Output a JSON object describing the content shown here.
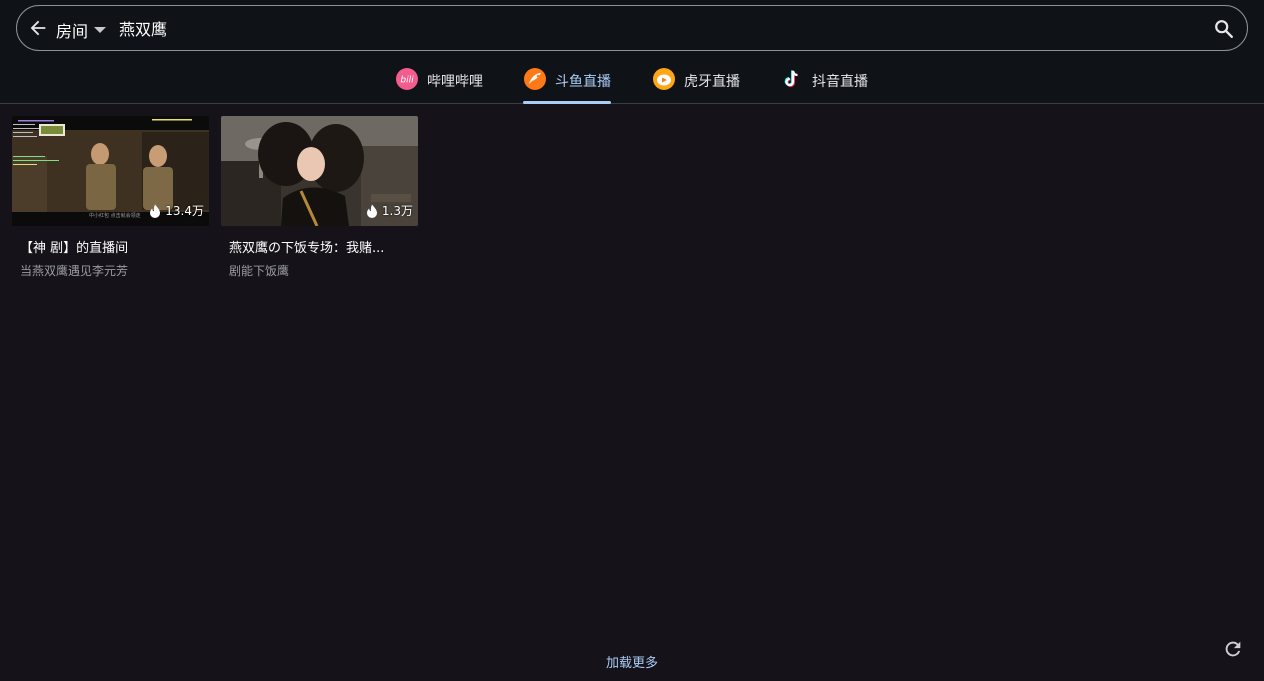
{
  "search": {
    "scope_label": "房间",
    "query": "燕双鹰"
  },
  "tabs": [
    {
      "label": "哔哩哔哩",
      "icon": "bilibili-icon",
      "active": false
    },
    {
      "label": "斗鱼直播",
      "icon": "douyu-icon",
      "active": true
    },
    {
      "label": "虎牙直播",
      "icon": "huya-icon",
      "active": false
    },
    {
      "label": "抖音直播",
      "icon": "douyin-icon",
      "active": false
    }
  ],
  "results": [
    {
      "title": "【神 剧】的直播间",
      "subtitle": "当燕双鹰遇见李元芳",
      "heat": "13.4万",
      "thumb_caption": "中小红包 点击就会领走"
    },
    {
      "title": "燕双鹰の下饭专场：我赌...",
      "subtitle": "剧能下饭鹰",
      "heat": "1.3万"
    }
  ],
  "footer": {
    "load_more": "加载更多"
  },
  "colors": {
    "background": "#151319",
    "topbar": "#0f1216",
    "accent": "#a9cdf5",
    "bilibili": "#f25d8e",
    "douyu": "#ff7a16",
    "huya": "#ffa616"
  }
}
